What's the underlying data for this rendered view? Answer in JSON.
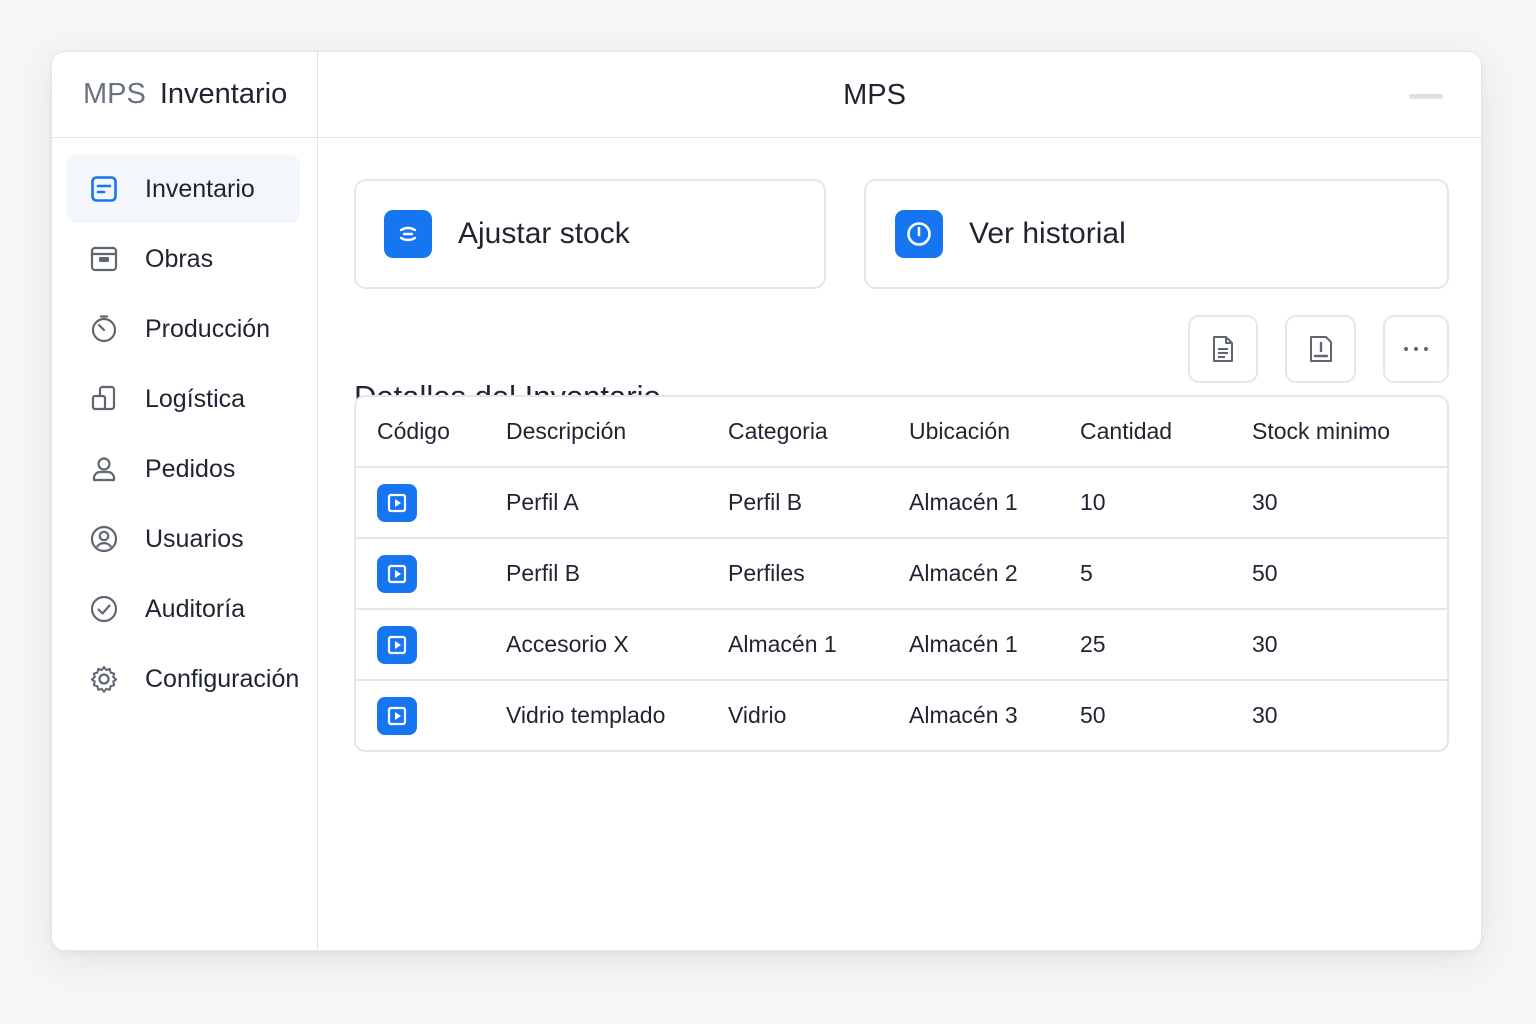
{
  "brand": {
    "part1": "MPS",
    "part2": "Inventario"
  },
  "header": {
    "title": "MPS"
  },
  "sidebar": {
    "items": [
      {
        "label": "Inventario",
        "icon": "inventory-icon",
        "active": true
      },
      {
        "label": "Obras",
        "icon": "box-icon",
        "active": false
      },
      {
        "label": "Producción",
        "icon": "timer-icon",
        "active": false
      },
      {
        "label": "Logística",
        "icon": "transfer-icon",
        "active": false
      },
      {
        "label": "Pedidos",
        "icon": "user-icon",
        "active": false
      },
      {
        "label": "Usuarios",
        "icon": "user-circle-icon",
        "active": false
      },
      {
        "label": "Auditoría",
        "icon": "check-circle-icon",
        "active": false
      },
      {
        "label": "Configuración",
        "icon": "gear-icon",
        "active": false
      }
    ]
  },
  "actions": {
    "adjust_label": "Ajustar stock",
    "history_label": "Ver historial"
  },
  "section": {
    "title": "Detalles del Inventario"
  },
  "table": {
    "headers": [
      "Código",
      "Descripción",
      "Categoria",
      "Ubicación",
      "Cantidad",
      "Stock minimo"
    ],
    "rows": [
      {
        "description": "Perfil A",
        "category": "Perfil B",
        "location": "Almacén 1",
        "quantity": "10",
        "min_stock": "30"
      },
      {
        "description": "Perfil B",
        "category": "Perfiles",
        "location": "Almacén 2",
        "quantity": "5",
        "min_stock": "50"
      },
      {
        "description": "Accesorio X",
        "category": "Almacén 1",
        "location": "Almacén 1",
        "quantity": "25",
        "min_stock": "30"
      },
      {
        "description": "Vidrio templado",
        "category": "Vidrio",
        "location": "Almacén 3",
        "quantity": "50",
        "min_stock": "30"
      }
    ]
  },
  "colors": {
    "accent": "#1676f2",
    "border": "#e3e7ed",
    "text": "#1f2430"
  }
}
